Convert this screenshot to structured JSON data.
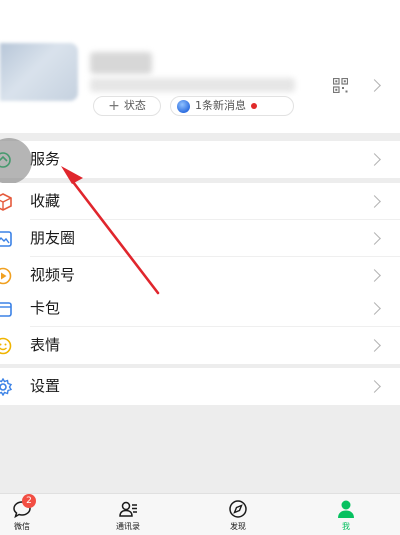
{
  "profile": {
    "status_label": "状态",
    "messages_label": "1条新消息"
  },
  "menu": {
    "services": "服务",
    "favorites": "收藏",
    "moments": "朋友圈",
    "channels": "视频号",
    "cards": "卡包",
    "stickers": "表情",
    "settings": "设置"
  },
  "tabbar": {
    "items": [
      {
        "label": "微信",
        "icon": "chat-bubble-icon",
        "badge": "2"
      },
      {
        "label": "通讯录",
        "icon": "contacts-icon"
      },
      {
        "label": "发现",
        "icon": "compass-icon"
      },
      {
        "label": "我",
        "icon": "person-icon"
      }
    ],
    "active": "我"
  },
  "colors": {
    "accent": "#07c160",
    "badge": "#f24e43",
    "annotation_arrow": "#e0262d"
  }
}
